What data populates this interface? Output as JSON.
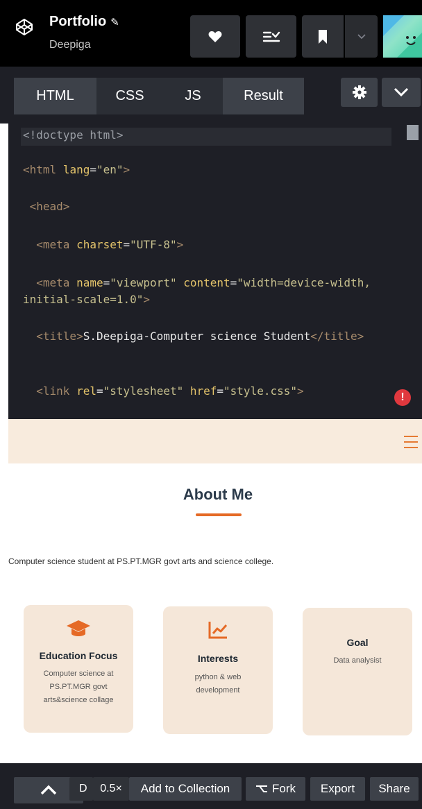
{
  "header": {
    "title": "Portfolio",
    "author": "Deepiga",
    "icons": [
      "codepen-logo-icon",
      "pencil-icon",
      "heart-icon",
      "collection-list-icon",
      "bookmark-icon",
      "chevron-down-icon",
      "avatar"
    ]
  },
  "editor": {
    "tabs": [
      {
        "label": "HTML"
      },
      {
        "label": "CSS"
      },
      {
        "label": "JS"
      },
      {
        "label": "Result"
      }
    ],
    "code_lines": [
      "<!doctype html>",
      "<html lang=\"en\">",
      "<head>",
      "<meta charset=\"UTF-8\">",
      "<meta name=\"viewport\" content=\"width=device-width, initial-scale=1.0\">",
      "<title>S.Deepiga-Computer science Student</title>",
      "<link rel=\"stylesheet\" href=\"style.css\">"
    ],
    "error_badge": "!"
  },
  "preview": {
    "heading": "About Me",
    "description": "Computer science student at PS.PT.MGR govt arts and science college.",
    "cards": [
      {
        "icon": "graduation-cap-icon",
        "title": "Education Focus",
        "text": "Computer science at PS.PT.MGR govt arts&science collage"
      },
      {
        "icon": "line-chart-icon",
        "title": "Interests",
        "text": "python & web development"
      },
      {
        "icon": "",
        "title": "Goal",
        "text": "Data analysist"
      }
    ],
    "accent": "#e56a26",
    "navbar_bg": "#f8ebdd",
    "card_bg": "#f5e7d9"
  },
  "bottom_bar": {
    "console_label": "D",
    "zoom": "0.5×",
    "add_to_collection": "Add to Collection",
    "fork": "Fork",
    "export": "Export",
    "share": "Share"
  }
}
